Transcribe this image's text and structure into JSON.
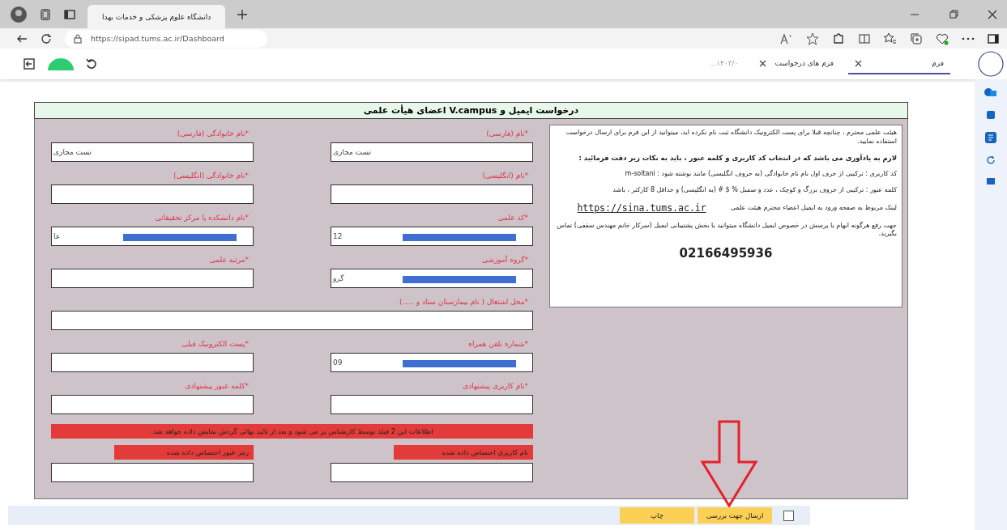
{
  "browser": {
    "tab_title": "دانشگاه علوم پزشکی و خدمات بهدا",
    "url": "https://sipad.tums.ac.ir/Dashboard"
  },
  "app_tabs": [
    {
      "label": "فرم",
      "closable": true,
      "selected": true
    },
    {
      "label": "فرم های درخواست",
      "closable": true,
      "selected": false
    },
    {
      "label": "۱۴۰۳/۰...",
      "closable": false,
      "selected": false
    }
  ],
  "form": {
    "title": "درخواست ایمیل و V.campus اعضای هیأت علمی",
    "fields": [
      {
        "kind": "half",
        "label": "*نام (فارسی)",
        "value": "تست مجازی",
        "redacted": false
      },
      {
        "kind": "half",
        "label": "*نام خانوادگی (فارسی)",
        "value": "تست مجازی",
        "redacted": false
      },
      {
        "kind": "half",
        "label": "*نام (انگلیسی)",
        "redacted": false
      },
      {
        "kind": "half",
        "label": "*نام خانوادگی (انگلیسی)",
        "redacted": false
      },
      {
        "kind": "half",
        "label": "*کد علمی",
        "value": "12",
        "redacted": true
      },
      {
        "kind": "half",
        "label": "*نام دانشکده یا مرکز تحقیقاتی",
        "value": "عا",
        "redacted": true
      },
      {
        "kind": "half",
        "label": "*گروه آموزشی",
        "value": "گرو",
        "redacted": true
      },
      {
        "kind": "half",
        "label": "*مرتبه علمی",
        "redacted": false
      },
      {
        "kind": "full",
        "label": "*محل اشتغال ( نام بیمارستان ستاد و .....)",
        "redacted": false
      },
      {
        "kind": "half",
        "label": "*شماره تلفن همراه",
        "value": "09",
        "redacted": true
      },
      {
        "kind": "half",
        "label": "*پست الکترونیک قبلی",
        "redacted": false
      },
      {
        "kind": "half",
        "label": "*نام کاربری پیشنهادی",
        "redacted": false
      },
      {
        "kind": "half",
        "label": "*کلمه عبور پیشنهادی",
        "redacted": false
      }
    ],
    "notice": "اطلاعات این 2 فیلد توسط کارشناس پر می شود و بعد از تائید نهائی گردش نمایش داده خواهد شد.",
    "assigned_fields": [
      {
        "label": "نام کاربری اختصاص داده شده"
      },
      {
        "label": "رمز عبور اختصاص داده شده"
      }
    ],
    "info": {
      "paragraphs": [
        {
          "text": "هیئت علمی محترم ، چنانچه قبلا برای پست الکترونیک دانشگاه ثبت نام نکرده اید، میتوانید از این فرم برای ارسال درخواست استفاده نمایید.",
          "bold": false
        },
        {
          "text": "لازم به یادآوری می باشد که در انتخاب کد کاربری و کلمه عبور ، باید به نکات زیر دقت فرمائید :",
          "bold": true
        },
        {
          "text": "کد کاربری : ترکیبی از حرف اول نام نام خانوادگی (به حروف انگلیسی) مانند نوشته شود :  m-soltani",
          "bold": false
        },
        {
          "text": "کلمه عبور : ترکیبی از حروف بزرگ و کوچک ، عدد و سمبل % $ # (به انگلیسی) و حداقل 8 کارکتر ، باشد",
          "bold": false
        }
      ],
      "link_caption": "لینک مربوط به صفحه ورود به ایمیل اعضاء محترم هیئت علمی",
      "link": "https://sina.tums.ac.ir",
      "support": "جهت رفع هرگونه ابهام یا پرسش در خصوص ایمیل دانشگاه میتوانید با بخش پشتیبانی ایمیل (سرکار خانم مهندس سقفی) تماس بگیرید.",
      "phone": "02166495936"
    }
  },
  "footer": {
    "checkbox": {
      "checked": false
    },
    "buttons": [
      "ارسال جهت بررسی",
      "چاپ"
    ]
  }
}
